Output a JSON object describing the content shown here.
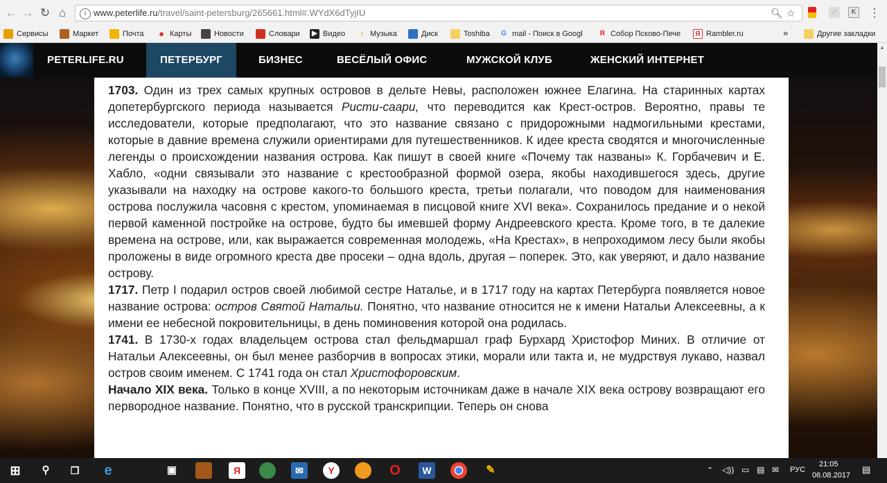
{
  "browser": {
    "url_host": "www.peterlife.ru",
    "url_path": "/travel/saint-petersburg/265661.html#.WYdX6dTyjIU",
    "bookmarks": [
      {
        "label": "Сервисы",
        "icon": "apps-grid-icon",
        "color": "#e8a000"
      },
      {
        "label": "Маркет",
        "icon": "market-icon",
        "color": "#e5a04a"
      },
      {
        "label": "Почта",
        "icon": "mail-icon",
        "color": "#f4b400"
      },
      {
        "label": "Карты",
        "icon": "map-pin-icon",
        "color": "#e03020"
      },
      {
        "label": "Новости",
        "icon": "news-icon",
        "color": "#444444"
      },
      {
        "label": "Словари",
        "icon": "dictionary-icon",
        "color": "#d03020"
      },
      {
        "label": "Видео",
        "icon": "video-icon",
        "color": "#222222"
      },
      {
        "label": "Музыка",
        "icon": "music-icon",
        "color": "#f0a000"
      },
      {
        "label": "Диск",
        "icon": "disk-icon",
        "color": "#3070c0"
      },
      {
        "label": "Toshiba",
        "icon": "folder-icon",
        "color": "#f4d060"
      },
      {
        "label": "mail - Поиск в Googl",
        "icon": "google-icon",
        "color": "#4285f4"
      },
      {
        "label": "Собор Псково-Пече",
        "icon": "yandex-icon",
        "color": "#e02020"
      },
      {
        "label": "Rambler.ru",
        "icon": "rambler-icon",
        "color": "#d03030"
      }
    ],
    "more_label": "»",
    "other_bookmarks": "Другие закладки"
  },
  "site_nav": [
    {
      "label": "PETERLIFE.RU",
      "active": false
    },
    {
      "label": "ПЕТЕРБУРГ",
      "active": true
    },
    {
      "label": "БИЗНЕС",
      "active": false
    },
    {
      "label": "ВЕСЁЛЫЙ ОФИС",
      "active": false
    },
    {
      "label": "МУЖСКОЙ КЛУБ",
      "active": false
    },
    {
      "label": "ЖЕНСКИЙ ИНТЕРНЕТ",
      "active": false
    }
  ],
  "article": {
    "p1": {
      "year": "1703.",
      "t1": " Один из трех самых крупных островов в дельте Невы, расположен южнее Елагина. На старинных картах допетербургского периода называется ",
      "em1": "Ристи-саари,",
      "t2": " что переводится как Крест-остров. Вероятно, правы те исследователи, которые предполагают, что это название связано с придорожными надмогильными крестами, которые в давние времена служили ориентирами для путешественников. К идее креста сводятся и многочисленные легенды о происхождении названия острова. Как пишут в своей книге «Почему так названы» К. Горбачевич и Е. Хабло, «одни связывали это название с крестообразной формой озера, якобы находившегося здесь, другие указывали на находку на острове какого-то большого креста, третьи полагали, что поводом для наименования острова послужила часовня с крестом, упоминаемая в писцовой книге XVI века». Сохранилось предание и о некой первой каменной постройке на острове, будто бы имевшей форму Андреевского креста. Кроме того, в те далекие времена на острове, или, как выражается современная молодежь, «На Крестах», в непроходимом лесу были якобы проложены в виде огромного креста две просеки – одна вдоль, другая – поперек. Это, как уверяют, и дало название острову."
    },
    "p2": {
      "year": "1717.",
      "t1": " Петр I подарил остров своей любимой сестре Наталье, и в 1717 году на картах Петербурга появляется новое название острова: ",
      "em1": "остров Святой Натальи.",
      "t2": " Понятно, что название относится не к имени Натальи Алексеевны, а к имени ее небесной покровительницы, в день поминовения которой она родилась."
    },
    "p3": {
      "year": "1741.",
      "t1": " В 1730-х годах владельцем острова стал фельдмаршал граф Бурхард Христофор Миних. В отличие от Натальи Алексеевны, он был менее разборчив в вопросах этики, морали или такта и, не мудрствуя лукаво, назвал остров своим именем. С 1741 года он стал ",
      "em1": "Христофоровским",
      "t2": "."
    },
    "p4": {
      "year": "Начало XIX века.",
      "t1": " Только в конце XVIII, а по некоторым источникам даже в начале XIX века острову возвращают его первородное название. Понятно, что в русской транскрипции. Теперь он снова"
    }
  },
  "taskbar": {
    "lang": "РУС",
    "time": "21:05",
    "date": "06.08.2017"
  }
}
